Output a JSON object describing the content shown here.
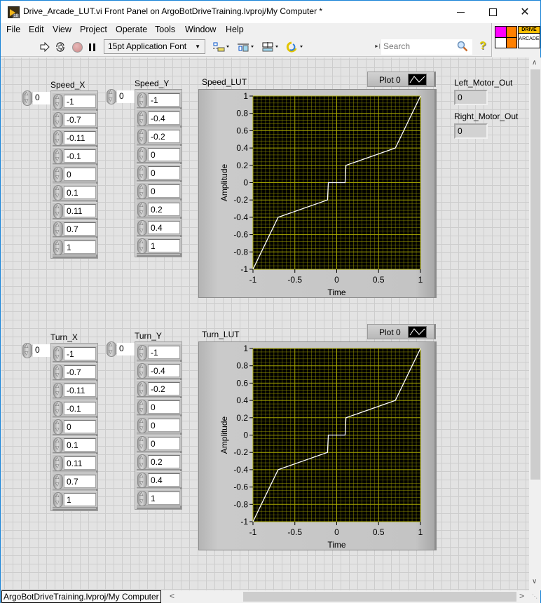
{
  "window": {
    "title": "Drive_Arcade_LUT.vi Front Panel on ArgoBotDriveTraining.lvproj/My Computer *",
    "minimize_icon": "minimize-icon",
    "maximize_icon": "maximize-icon",
    "close_icon": "close-icon"
  },
  "menu": [
    "File",
    "Edit",
    "View",
    "Project",
    "Operate",
    "Tools",
    "Window",
    "Help"
  ],
  "toolbar": {
    "run_icon": "run-arrow-icon",
    "run_continuous_icon": "run-continuously-icon",
    "abort_icon": "abort-stop-icon",
    "pause_icon": "pause-icon",
    "font_select": "15pt Application Font",
    "align_icon": "align-objects-icon",
    "distribute_icon": "distribute-objects-icon",
    "resize_icon": "resize-objects-icon",
    "reorder_icon": "reorder-icon",
    "search_placeholder": "Search",
    "search_icon": "magnifier-icon",
    "help_icon": "context-help-icon"
  },
  "vi_icon": {
    "line1": "DRIVE",
    "line2": "ARCADE",
    "colors": {
      "magenta": "#ff00ff",
      "orange": "#ff8000",
      "yellow": "#ffc000",
      "white": "#ffffff"
    }
  },
  "groups": [
    {
      "x_array": {
        "label": "Speed_X",
        "index": "0",
        "values": [
          "-1",
          "-0.7",
          "-0.11",
          "-0.1",
          "0",
          "0.1",
          "0.11",
          "0.7",
          "1"
        ]
      },
      "y_array": {
        "label": "Speed_Y",
        "index": "0",
        "values": [
          "-1",
          "-0.4",
          "-0.2",
          "0",
          "0",
          "0",
          "0.2",
          "0.4",
          "1"
        ]
      },
      "graph": {
        "label": "Speed_LUT",
        "legend": "Plot 0"
      }
    },
    {
      "x_array": {
        "label": "Turn_X",
        "index": "0",
        "values": [
          "-1",
          "-0.7",
          "-0.11",
          "-0.1",
          "0",
          "0.1",
          "0.11",
          "0.7",
          "1"
        ]
      },
      "y_array": {
        "label": "Turn_Y",
        "index": "0",
        "values": [
          "-1",
          "-0.4",
          "-0.2",
          "0",
          "0",
          "0",
          "0.2",
          "0.4",
          "1"
        ]
      },
      "graph": {
        "label": "Turn_LUT",
        "legend": "Plot 0"
      }
    }
  ],
  "outputs": [
    {
      "label": "Left_Motor_Out",
      "value": "0"
    },
    {
      "label": "Right_Motor_Out",
      "value": "0"
    }
  ],
  "statusbar": {
    "path": "ArgoBotDriveTraining.lvproj/My Computer"
  },
  "colors": {
    "plot_bg": "#000000",
    "grid": "#a8a800",
    "plot_line": "#ffffff",
    "panel_bg": "#e3e3e3"
  },
  "chart_data": [
    {
      "type": "line",
      "title": "Speed_LUT",
      "xlabel": "Time",
      "ylabel": "Amplitude",
      "xlim": [
        -1,
        1
      ],
      "ylim": [
        -1,
        1
      ],
      "xticks": [
        "-1",
        "-0.5",
        "0",
        "0.5",
        "1"
      ],
      "yticks": [
        "-1",
        "-0.8",
        "-0.6",
        "-0.4",
        "-0.2",
        "0",
        "0.2",
        "0.4",
        "0.6",
        "0.8",
        "1"
      ],
      "grid": true,
      "legend": "top-right",
      "series": [
        {
          "name": "Plot 0",
          "x": [
            -1,
            -0.7,
            -0.11,
            -0.1,
            0,
            0.1,
            0.11,
            0.7,
            1
          ],
          "y": [
            -1,
            -0.4,
            -0.2,
            0,
            0,
            0,
            0.2,
            0.4,
            1
          ]
        }
      ]
    },
    {
      "type": "line",
      "title": "Turn_LUT",
      "xlabel": "Time",
      "ylabel": "Amplitude",
      "xlim": [
        -1,
        1
      ],
      "ylim": [
        -1,
        1
      ],
      "xticks": [
        "-1",
        "-0.5",
        "0",
        "0.5",
        "1"
      ],
      "yticks": [
        "-1",
        "-0.8",
        "-0.6",
        "-0.4",
        "-0.2",
        "0",
        "0.2",
        "0.4",
        "0.6",
        "0.8",
        "1"
      ],
      "grid": true,
      "legend": "top-right",
      "series": [
        {
          "name": "Plot 0",
          "x": [
            -1,
            -0.7,
            -0.11,
            -0.1,
            0,
            0.1,
            0.11,
            0.7,
            1
          ],
          "y": [
            -1,
            -0.4,
            -0.2,
            0,
            0,
            0,
            0.2,
            0.4,
            1
          ]
        }
      ]
    }
  ]
}
